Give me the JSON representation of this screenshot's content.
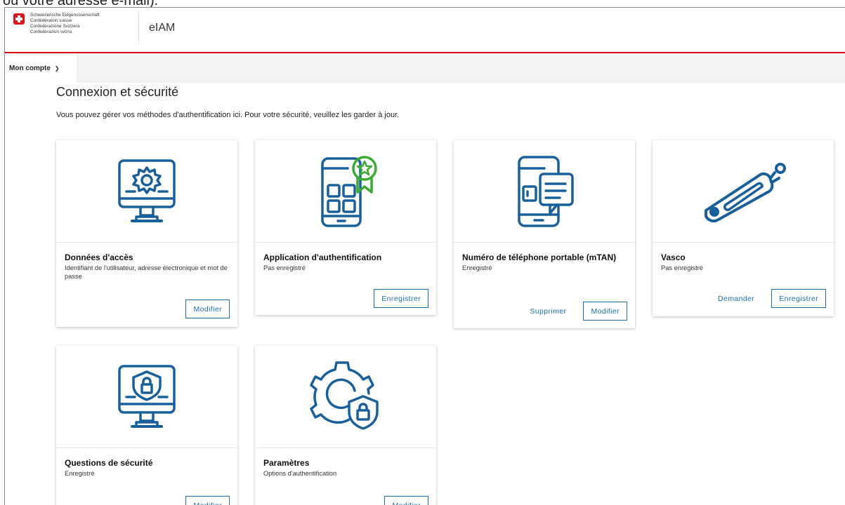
{
  "cropped_text": "ou votre adresse e-mail).",
  "header": {
    "confederation_lines": [
      "Schweizerische Eidgenossenschaft",
      "Confédération suisse",
      "Confederazione Svizzera",
      "Confederaziun svizra"
    ],
    "app_name": "eIAM"
  },
  "nav": {
    "account_label": "Mon compte"
  },
  "page": {
    "title": "Connexion et sécurité",
    "description": "Vous pouvez gérer vos méthodes d'authentification ici. Pour votre sécurité, veuillez les garder à jour."
  },
  "cards": [
    {
      "title": "Données d'accès",
      "subtitle": "Identifiant de l'utilisateur, adresse électronique et mot de passe",
      "primary": "Modifier",
      "icon": "monitor-gear-icon"
    },
    {
      "title": "Application d'authentification",
      "subtitle": "Pas enregistré",
      "primary": "Enregistrer",
      "icon": "phone-apps-badge-icon"
    },
    {
      "title": "Numéro de téléphone portable (mTAN)",
      "subtitle": "Enregistré",
      "secondary": "Supprimer",
      "primary": "Modifier",
      "icon": "phone-message-icon"
    },
    {
      "title": "Vasco",
      "subtitle": "Pas enregistré",
      "secondary": "Demander",
      "primary": "Enregistrer",
      "icon": "usb-token-icon"
    },
    {
      "title": "Questions de sécurité",
      "subtitle": "Enregistré",
      "primary": "Modifier",
      "icon": "monitor-shield-lock-icon"
    },
    {
      "title": "Paramètres",
      "subtitle": "Options d'authentification",
      "primary": "Modifier",
      "icon": "gear-shield-lock-icon"
    }
  ],
  "colors": {
    "accent": "#1a6ea8",
    "icon_blue": "#19609a",
    "badge_green": "#3aaa35",
    "swiss_red": "#dc0018"
  }
}
